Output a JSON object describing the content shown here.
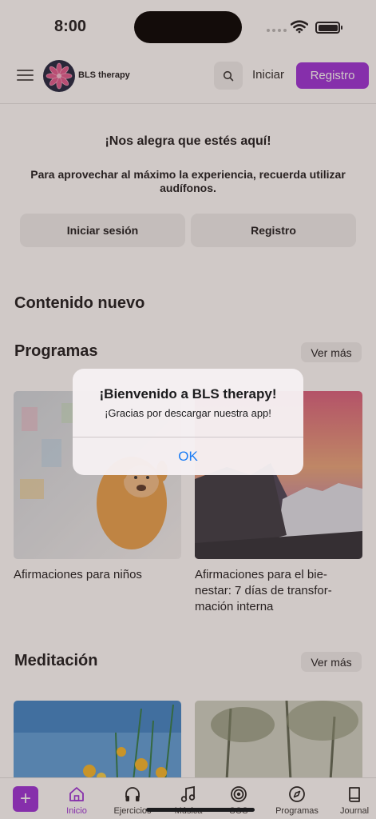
{
  "status_bar": {
    "time": "8:00"
  },
  "header": {
    "brand": "BLS therapy",
    "login_label": "Iniciar",
    "register_label": "Registro"
  },
  "welcome": {
    "title": "¡Nos alegra que estés aquí!",
    "subtitle": "Para aprovechar al máximo la experiencia, recuerda utilizar audífonos.",
    "login_button": "Iniciar sesión",
    "register_button": "Registro"
  },
  "new_content": {
    "heading": "Contenido nuevo"
  },
  "programs": {
    "heading": "Programas",
    "see_more": "Ver más",
    "cards": [
      {
        "title": "Afirmaciones para niños"
      },
      {
        "title": "Afirmaciones para el bie- nestar: 7 días de transfor- mación interna"
      }
    ]
  },
  "meditation": {
    "heading": "Meditación",
    "see_more": "Ver más"
  },
  "alert": {
    "title": "¡Bienvenido a BLS therapy!",
    "message": "¡Gracias por descargar nuestra app!",
    "ok": "OK"
  },
  "tab_bar": {
    "tabs": [
      {
        "label": "Inicio",
        "icon": "home-icon",
        "active": true
      },
      {
        "label": "Ejercicios",
        "icon": "headphones-icon",
        "active": false
      },
      {
        "label": "Música",
        "icon": "music-note-icon",
        "active": false
      },
      {
        "label": "SOS",
        "icon": "sos-target-icon",
        "active": false
      },
      {
        "label": "Programas",
        "icon": "compass-icon",
        "active": false
      },
      {
        "label": "Journal",
        "icon": "book-icon",
        "active": false
      }
    ]
  },
  "colors": {
    "accent": "#9b30d9",
    "alert_link": "#1a7cf5"
  }
}
